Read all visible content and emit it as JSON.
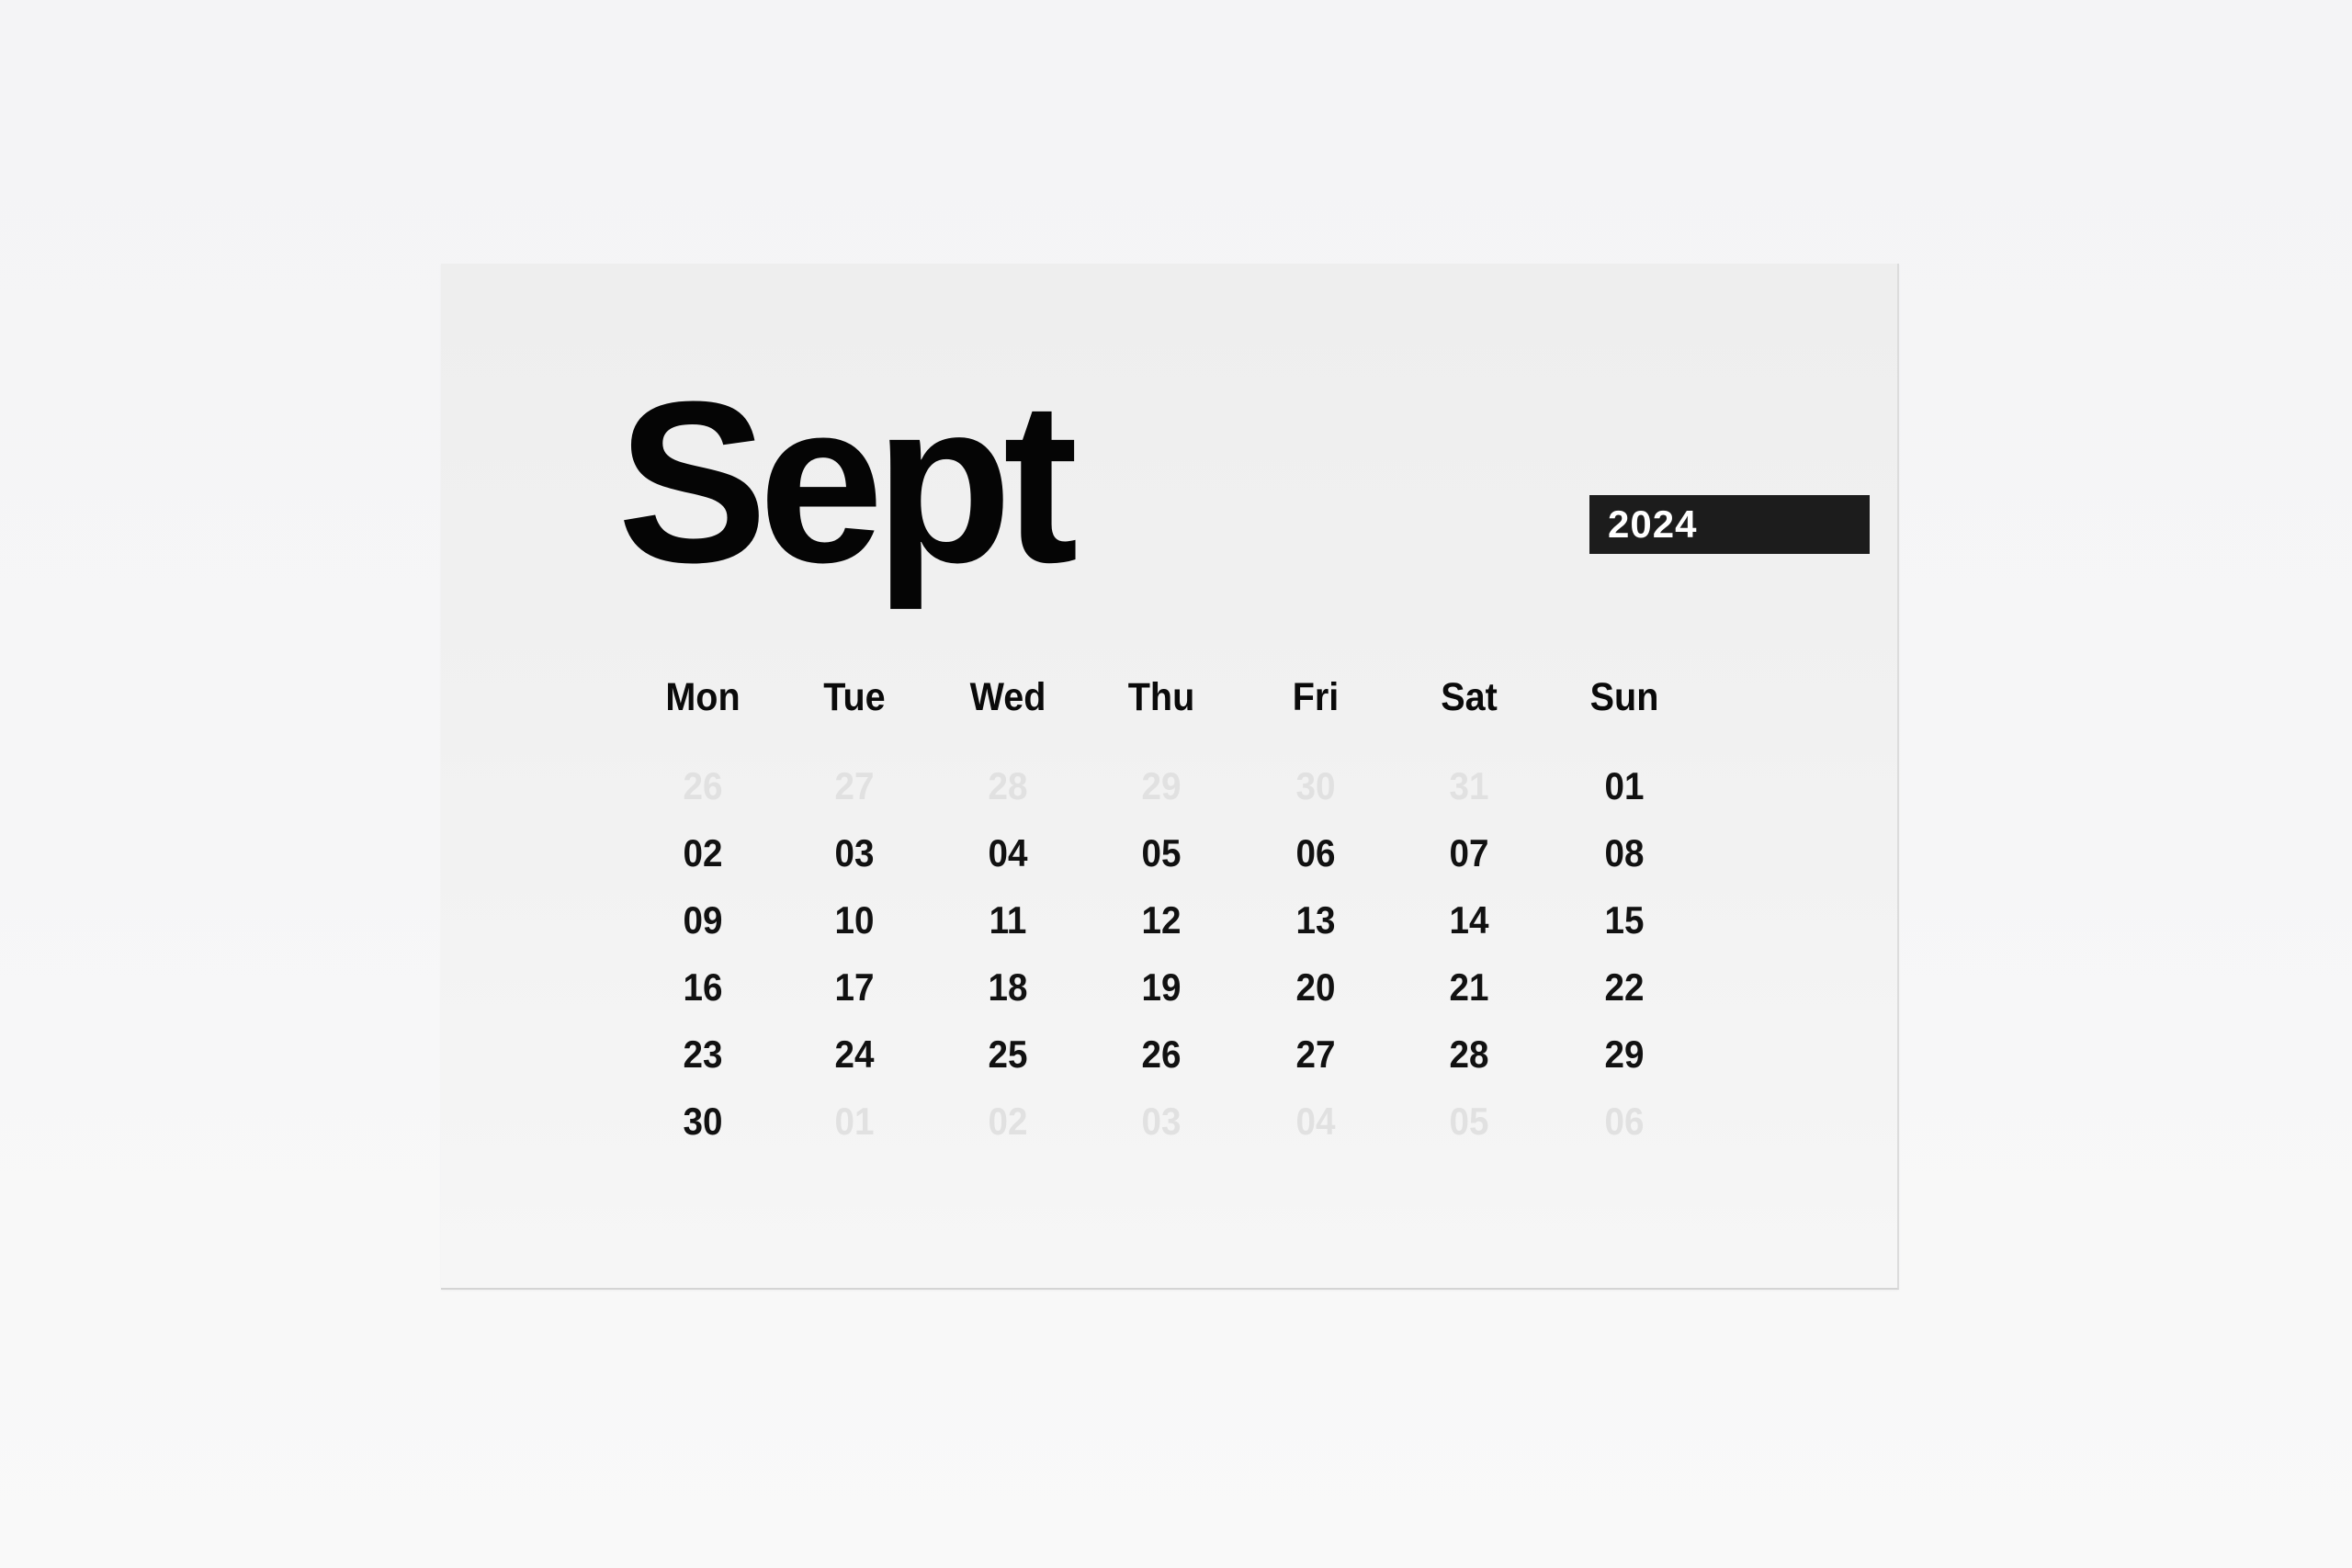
{
  "calendar": {
    "month": "Sept",
    "year": "2024",
    "colors": {
      "text": "#111111",
      "muted_text": "#e1e1e1",
      "year_badge_bg": "#1c1c1c",
      "year_badge_text": "#ffffff",
      "card_bg": "#f0f0f0"
    },
    "weekdays": [
      "Mon",
      "Tue",
      "Wed",
      "Thu",
      "Fri",
      "Sat",
      "Sun"
    ],
    "weeks": [
      [
        {
          "d": "26",
          "muted": true
        },
        {
          "d": "27",
          "muted": true
        },
        {
          "d": "28",
          "muted": true
        },
        {
          "d": "29",
          "muted": true
        },
        {
          "d": "30",
          "muted": true
        },
        {
          "d": "31",
          "muted": true
        },
        {
          "d": "01",
          "muted": false
        }
      ],
      [
        {
          "d": "02",
          "muted": false
        },
        {
          "d": "03",
          "muted": false
        },
        {
          "d": "04",
          "muted": false
        },
        {
          "d": "05",
          "muted": false
        },
        {
          "d": "06",
          "muted": false
        },
        {
          "d": "07",
          "muted": false
        },
        {
          "d": "08",
          "muted": false
        }
      ],
      [
        {
          "d": "09",
          "muted": false
        },
        {
          "d": "10",
          "muted": false
        },
        {
          "d": "11",
          "muted": false
        },
        {
          "d": "12",
          "muted": false
        },
        {
          "d": "13",
          "muted": false
        },
        {
          "d": "14",
          "muted": false
        },
        {
          "d": "15",
          "muted": false
        }
      ],
      [
        {
          "d": "16",
          "muted": false
        },
        {
          "d": "17",
          "muted": false
        },
        {
          "d": "18",
          "muted": false
        },
        {
          "d": "19",
          "muted": false
        },
        {
          "d": "20",
          "muted": false
        },
        {
          "d": "21",
          "muted": false
        },
        {
          "d": "22",
          "muted": false
        }
      ],
      [
        {
          "d": "23",
          "muted": false
        },
        {
          "d": "24",
          "muted": false
        },
        {
          "d": "25",
          "muted": false
        },
        {
          "d": "26",
          "muted": false
        },
        {
          "d": "27",
          "muted": false
        },
        {
          "d": "28",
          "muted": false
        },
        {
          "d": "29",
          "muted": false
        }
      ],
      [
        {
          "d": "30",
          "muted": false
        },
        {
          "d": "01",
          "muted": true
        },
        {
          "d": "02",
          "muted": true
        },
        {
          "d": "03",
          "muted": true
        },
        {
          "d": "04",
          "muted": true
        },
        {
          "d": "05",
          "muted": true
        },
        {
          "d": "06",
          "muted": true
        }
      ]
    ]
  }
}
